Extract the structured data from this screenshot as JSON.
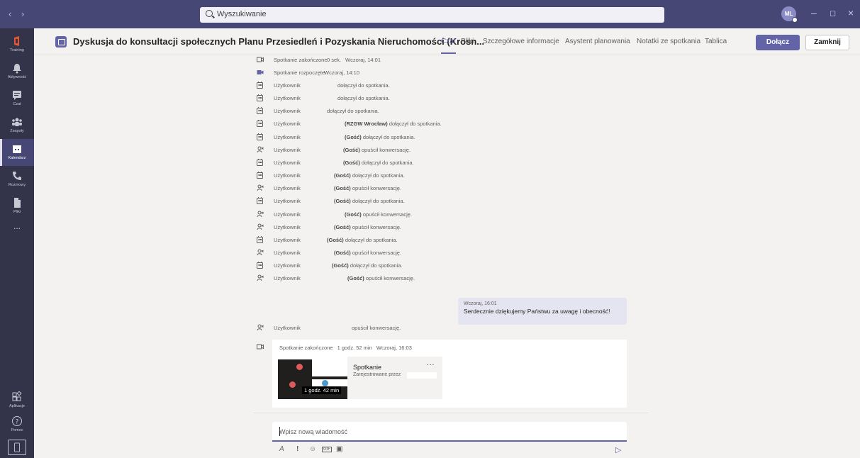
{
  "titlebar": {
    "back_glyph": "‹",
    "forward_glyph": "›",
    "search_placeholder": "Wyszukiwanie",
    "avatar_initials": "ML",
    "minimize_glyph": "–",
    "maximize_glyph": "◻",
    "close_glyph": "×",
    "color": "#464775"
  },
  "rail": {
    "items": [
      {
        "label": "Training",
        "icon": "office-icon"
      },
      {
        "label": "Aktywność",
        "icon": "bell-icon"
      },
      {
        "label": "Czat",
        "icon": "chat-icon"
      },
      {
        "label": "Zespoły",
        "icon": "teams-icon"
      },
      {
        "label": "Kalendarz",
        "icon": "calendar-icon",
        "active": true
      },
      {
        "label": "Rozmowy",
        "icon": "phone-icon"
      },
      {
        "label": "Pliki",
        "icon": "file-icon"
      },
      {
        "label": "...",
        "icon": "more-icon"
      }
    ],
    "apps_label": "Aplikacje",
    "help_label": "Pomoc",
    "background": "#33344a"
  },
  "header": {
    "title": "Dyskusja do konsultacji społecznych Planu Przesiedleń i Pozyskania Nieruchomości (Krosn...",
    "tabs": [
      "Czat",
      "Pliki",
      "Szczegółowe informacje",
      "Asystent planowania",
      "Notatki ze spotkania",
      "Tablica"
    ],
    "active_tab": "Czat",
    "join_label": "Dołącz",
    "close_label": "Zamknij",
    "accent": "#6264a7"
  },
  "chat": {
    "meeting_ended_top": "Spotkanie zakończone",
    "meeting_ended_top_duration": "0 sek.",
    "meeting_ended_top_time": "Wczoraj, 14:01",
    "meeting_started": "Spotkanie rozpoczęte",
    "meeting_started_time": "Wczoraj, 14:10",
    "user_word": "Użytkownik",
    "events": [
      {
        "type": "joined",
        "guest": "",
        "text": "dołączył do spotkania."
      },
      {
        "type": "joined",
        "guest": "",
        "text": "dołączył do spotkania."
      },
      {
        "type": "joined",
        "guest": "",
        "text": "dołączył do spotkania."
      },
      {
        "type": "joined",
        "guest": "(RZGW Wrocław)",
        "text": "dołączył do spotkania."
      },
      {
        "type": "joined",
        "guest": "(Gość)",
        "text": "dołączył do spotkania."
      },
      {
        "type": "left",
        "guest": "(Gość)",
        "text": "opuścił konwersację."
      },
      {
        "type": "joined",
        "guest": "(Gość)",
        "text": "dołączył do spotkania."
      },
      {
        "type": "joined",
        "guest": "(Gość)",
        "text": "dołączył do spotkania."
      },
      {
        "type": "left",
        "guest": "(Gość)",
        "text": "opuścił konwersację."
      },
      {
        "type": "joined",
        "guest": "(Gość)",
        "text": "dołączył do spotkania."
      },
      {
        "type": "left",
        "guest": "(Gość)",
        "text": "opuścił konwersację."
      },
      {
        "type": "left",
        "guest": "(Gość)",
        "text": "opuścił konwersację."
      },
      {
        "type": "joined",
        "guest": "(Gość)",
        "text": "dołączył do spotkania."
      },
      {
        "type": "left",
        "guest": "(Gość)",
        "text": "opuścił konwersację."
      },
      {
        "type": "joined",
        "guest": "(Gość)",
        "text": "dołączył do spotkania."
      },
      {
        "type": "left",
        "guest": "(Gość)",
        "text": "opuścił konwersację."
      }
    ],
    "message": {
      "time": "Wczoraj, 16:01",
      "text": "Serdecznie dziękujemy Państwu za uwagę i obecność!"
    },
    "left_event_text": "opuścił konwersację.",
    "meeting_end": {
      "label": "Spotkanie zakończone",
      "duration": "1 godz. 52 min",
      "time": "Wczoraj, 16:03"
    },
    "recording": {
      "title": "Spotkanie",
      "subtitle": "Zarejestrowane przez",
      "duration": "1 godz. 42 min",
      "more": "..."
    }
  },
  "composer": {
    "placeholder": "Wpisz nową wiadomość",
    "tools": [
      "format-icon",
      "important-icon",
      "emoji-icon",
      "gif-icon",
      "sticker-icon"
    ],
    "tool_glyphs": [
      "A",
      "!",
      "☺",
      "GIF",
      "▣"
    ],
    "send_glyph": "▷"
  }
}
